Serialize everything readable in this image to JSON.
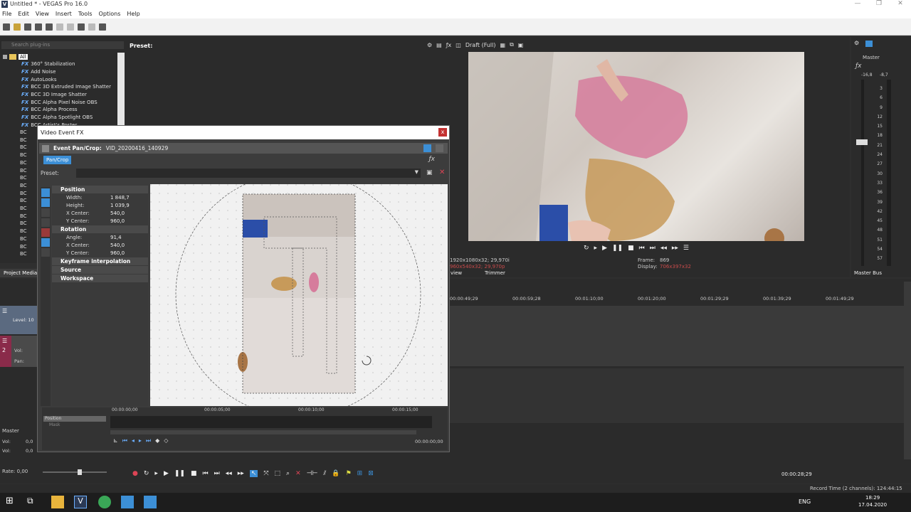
{
  "window": {
    "title": "Untitled * - VEGAS Pro 16.0",
    "min": "—",
    "max": "❐",
    "close": "✕"
  },
  "menu": [
    "File",
    "Edit",
    "View",
    "Insert",
    "Tools",
    "Options",
    "Help"
  ],
  "fx_panel": {
    "search_placeholder": "Search plug-ins",
    "root": "All",
    "preset_label": "Preset:",
    "items": [
      "360° Stabilization",
      "Add Noise",
      "AutoLooks",
      "BCC 3D Extruded Image Shatter",
      "BCC 3D Image Shatter",
      "BCC Alpha Pixel Noise OBS",
      "BCC Alpha Process",
      "BCC Alpha Spotlight OBS",
      "BCC Artist's Poster"
    ],
    "collapsed_prefix": "BC",
    "tab": "Project Media"
  },
  "preview": {
    "mode": "Draft (Full)",
    "info_left_1": "1920x1080x32; 29,970i",
    "info_left_2": "960x540x32; 29,970p",
    "frame_label": "Frame:",
    "frame_value": "869",
    "display_label": "Display:",
    "display_value": "706x397x32",
    "tab_view": "view",
    "tab_trimmer": "Trimmer"
  },
  "master": {
    "title": "Master",
    "peak_left": "-16,8",
    "peak_right": "-8,7",
    "scale": [
      "3",
      "6",
      "9",
      "12",
      "15",
      "18",
      "21",
      "24",
      "27",
      "30",
      "33",
      "36",
      "39",
      "42",
      "45",
      "48",
      "51",
      "54",
      "57"
    ],
    "bus_tab": "Master Bus"
  },
  "timeline": {
    "ruler": [
      "00:00:49;29",
      "00:00:59;28",
      "00:01:10;00",
      "00:01:20;00",
      "00:01:29;29",
      "00:01:39;29",
      "00:01:49;29"
    ],
    "cursor_time": "00:00:28;29",
    "record_time": "Record Time (2 channels): 124:44:15"
  },
  "tracks": {
    "video_level": "Level: 10",
    "audio_vol": "Vol:",
    "audio_pan": "Pan:",
    "track2_num": "2",
    "master_label": "Master",
    "master_vol1": "Vol:",
    "master_vol1_val": "0,0",
    "master_vol2": "Vol:",
    "master_vol2_val": "0,0",
    "rate": "Rate: 0,00"
  },
  "dialog": {
    "title": "Video Event FX",
    "close": "x",
    "event_label": "Event Pan/Crop:",
    "event_name": "VID_20200416_140929",
    "chain_tag": "Pan/Crop",
    "preset_label": "Preset:",
    "sections": {
      "position": "Position",
      "rotation": "Rotation",
      "keyframe": "Keyframe interpolation",
      "source": "Source",
      "workspace": "Workspace"
    },
    "position_rows": [
      {
        "k": "Width:",
        "v": "1 848,7"
      },
      {
        "k": "Height:",
        "v": "1 039,9"
      },
      {
        "k": "X Center:",
        "v": "540,0"
      },
      {
        "k": "Y Center:",
        "v": "960,0"
      }
    ],
    "rotation_rows": [
      {
        "k": "Angle:",
        "v": "91,4"
      },
      {
        "k": "X Center:",
        "v": "540,0"
      },
      {
        "k": "Y Center:",
        "v": "960,0"
      }
    ],
    "kf_ruler": [
      "00:00:00;00",
      "00:00:05;00",
      "00:00:10;00",
      "00:00:15;00"
    ],
    "kf_tracks": [
      "Position",
      "Mask"
    ],
    "kf_time": "00:00:00;00"
  },
  "taskbar": {
    "lang": "ENG",
    "time": "18:29",
    "date": "17.04.2020"
  },
  "colors": {
    "accent": "#3c8fd6",
    "dialog_close": "#c43232",
    "audio_track": "#8a2b4a",
    "video_track": "#5b6a80"
  }
}
